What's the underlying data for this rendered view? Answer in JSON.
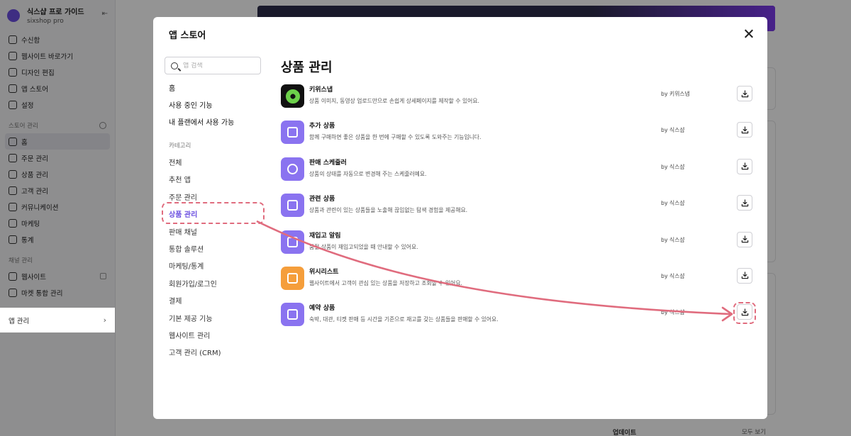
{
  "sidebar": {
    "shop_name": "식스샵 프로 가이드",
    "shop_sub": "sixshop pro",
    "top_items": [
      {
        "label": "수신함",
        "icon": "bell-icon"
      },
      {
        "label": "웹사이트 바로가기",
        "icon": "window-icon"
      },
      {
        "label": "디자인 편집",
        "icon": "pencil-icon"
      },
      {
        "label": "앱 스토어",
        "icon": "apps-icon"
      },
      {
        "label": "설정",
        "icon": "gear-icon"
      }
    ],
    "store_section": "스토어 관리",
    "store_items": [
      {
        "label": "홈",
        "icon": "home-icon"
      },
      {
        "label": "주문 관리",
        "icon": "box-icon"
      },
      {
        "label": "상품 관리",
        "icon": "bag-icon"
      },
      {
        "label": "고객 관리",
        "icon": "chevron-down-icon"
      },
      {
        "label": "커뮤니케이션",
        "icon": "chat-icon"
      },
      {
        "label": "마케팅",
        "icon": "target-icon"
      },
      {
        "label": "통계",
        "icon": "chart-icon"
      }
    ],
    "channel_section": "채널 관리",
    "channel_items": [
      {
        "label": "웹사이트",
        "icon": "grid-icon"
      },
      {
        "label": "마켓 통합 관리",
        "icon": "grid-icon"
      }
    ],
    "app_manage": "앱 관리"
  },
  "background": {
    "footer_left": "업데이트",
    "footer_right": "모두 보기"
  },
  "modal": {
    "title": "앱 스토어",
    "search_placeholder": "앱 검색",
    "top_links": [
      "홈",
      "사용 중인 기능",
      "내 플랜에서 사용 가능"
    ],
    "category_label": "카테고리",
    "categories": [
      "전체",
      "추천 앱",
      "주문 관리",
      "상품 관리",
      "판매 채널",
      "통합 솔루션",
      "마케팅/통계",
      "회원가입/로그인",
      "결제",
      "기본 제공 기능",
      "웹사이트 관리",
      "고객 관리 (CRM)"
    ],
    "selected_category": "상품 관리",
    "content_title": "상품 관리",
    "apps": [
      {
        "name": "키위스냅",
        "desc": "상품 이미지, 동영상 업로드만으로 손쉽게 상세페이지를 제작할 수 있어요.",
        "by": "by 키위스냅",
        "icon": "camera-lens-icon",
        "color": "#111111"
      },
      {
        "name": "추가 상품",
        "desc": "함께 구매하면 좋은 상품을 한 번에 구매할 수 있도록 도와주는 기능입니다.",
        "by": "by 식스샵",
        "icon": "bag-plus-icon",
        "color": "#8a73f0"
      },
      {
        "name": "판매 스케줄러",
        "desc": "상품의 상태를 자동으로 변경해 주는 스케줄러예요.",
        "by": "by 식스샵",
        "icon": "timer-icon",
        "color": "#8a73f0"
      },
      {
        "name": "관련 상품",
        "desc": "상품과 관련이 있는 상품들을 노출해 끊임없는 탐색 경험을 제공해요.",
        "by": "by 식스샵",
        "icon": "squares-icon",
        "color": "#8a73f0"
      },
      {
        "name": "재입고 알림",
        "desc": "품절 상품이 재입고되었을 때 안내할 수 있어요.",
        "by": "by 식스샵",
        "icon": "megaphone-icon",
        "color": "#8a73f0"
      },
      {
        "name": "위시리스트",
        "desc": "웹사이트에서 고객이 관심 있는 상품을 저장하고 조회할 수 있어요.",
        "by": "by 식스샵",
        "icon": "heart-box-icon",
        "color": "#f59e3b"
      },
      {
        "name": "예약 상품",
        "desc": "숙박, 대관, 티켓 판매 등 시간을 기준으로 재고를 갖는 상품들을 판매할 수 있어요.",
        "by": "by 식스샵",
        "icon": "calendar-icon",
        "color": "#8a73f0"
      }
    ]
  }
}
